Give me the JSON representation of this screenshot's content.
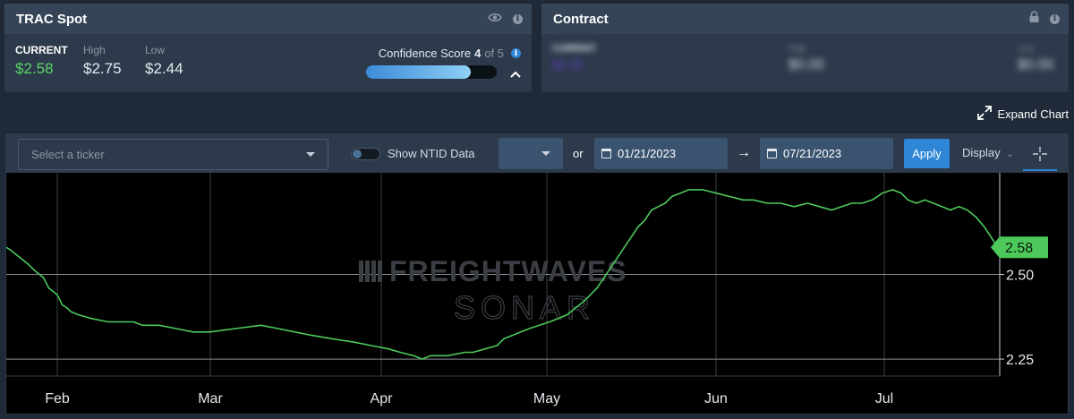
{
  "spot": {
    "title": "TRAC Spot",
    "icons": [
      "eye-icon",
      "info-icon"
    ],
    "current_label": "CURRENT",
    "current_value": "$2.58",
    "high_label": "High",
    "high_value": "$2.75",
    "low_label": "Low",
    "low_value": "$2.44",
    "confidence_label": "Confidence Score",
    "confidence_score": "4",
    "confidence_of": "of 5",
    "confidence_fraction": 0.8
  },
  "contract": {
    "title": "Contract",
    "icons": [
      "lock-icon",
      "info-icon"
    ],
    "current_label": "CURRENT",
    "current_value": "$0.00",
    "high_label": "High",
    "high_value": "$0.00",
    "low_label": "Low",
    "low_value": "$0.00"
  },
  "expand_label": "Expand Chart",
  "toolbar": {
    "ticker_placeholder": "Select a ticker",
    "ntid_label": "Show NTID Data",
    "or_label": "or",
    "start_date": "01/21/2023",
    "end_date": "07/21/2023",
    "apply_label": "Apply",
    "display_label": "Display"
  },
  "watermark": {
    "line1": "FREIGHTWAVES",
    "line2": "SONAR"
  },
  "colors": {
    "line": "#4cc95a",
    "accent": "#2f86d6",
    "positive": "#5fd36a"
  },
  "chart_data": {
    "type": "line",
    "x_labels": [
      "Feb",
      "Mar",
      "Apr",
      "May",
      "Jun",
      "Jul"
    ],
    "y_ticks": [
      "2.25",
      "2.50"
    ],
    "ylim": [
      2.2,
      2.8
    ],
    "last_value_label": "2.58",
    "series": [
      {
        "values": [
          [
            0,
            2.58
          ],
          [
            3,
            2.57
          ],
          [
            8,
            2.55
          ],
          [
            13,
            2.53
          ],
          [
            17,
            2.51
          ],
          [
            22,
            2.49
          ],
          [
            25,
            2.46
          ],
          [
            30,
            2.44
          ],
          [
            33,
            2.41
          ],
          [
            36,
            2.4
          ],
          [
            38,
            2.39
          ],
          [
            43,
            2.38
          ],
          [
            50,
            2.37
          ],
          [
            60,
            2.36
          ],
          [
            75,
            2.36
          ],
          [
            80,
            2.35
          ],
          [
            90,
            2.35
          ],
          [
            100,
            2.34
          ],
          [
            110,
            2.33
          ],
          [
            120,
            2.33
          ],
          [
            135,
            2.34
          ],
          [
            150,
            2.35
          ],
          [
            160,
            2.34
          ],
          [
            170,
            2.33
          ],
          [
            180,
            2.32
          ],
          [
            192,
            2.31
          ],
          [
            205,
            2.3
          ],
          [
            215,
            2.29
          ],
          [
            225,
            2.28
          ],
          [
            232,
            2.27
          ],
          [
            240,
            2.26
          ],
          [
            245,
            2.25
          ],
          [
            250,
            2.26
          ],
          [
            260,
            2.26
          ],
          [
            270,
            2.27
          ],
          [
            275,
            2.27
          ],
          [
            282,
            2.28
          ],
          [
            289,
            2.29
          ],
          [
            293,
            2.31
          ],
          [
            298,
            2.32
          ],
          [
            303,
            2.33
          ],
          [
            308,
            2.34
          ],
          [
            314,
            2.35
          ],
          [
            320,
            2.36
          ],
          [
            325,
            2.37
          ],
          [
            330,
            2.38
          ],
          [
            335,
            2.4
          ],
          [
            340,
            2.42
          ],
          [
            344,
            2.44
          ],
          [
            348,
            2.46
          ],
          [
            352,
            2.49
          ],
          [
            356,
            2.52
          ],
          [
            360,
            2.55
          ],
          [
            364,
            2.58
          ],
          [
            368,
            2.61
          ],
          [
            372,
            2.64
          ],
          [
            376,
            2.66
          ],
          [
            380,
            2.69
          ],
          [
            384,
            2.7
          ],
          [
            388,
            2.71
          ],
          [
            392,
            2.73
          ],
          [
            397,
            2.74
          ],
          [
            402,
            2.75
          ],
          [
            410,
            2.75
          ],
          [
            418,
            2.74
          ],
          [
            426,
            2.73
          ],
          [
            434,
            2.72
          ],
          [
            440,
            2.72
          ],
          [
            448,
            2.71
          ],
          [
            456,
            2.71
          ],
          [
            464,
            2.7
          ],
          [
            472,
            2.71
          ],
          [
            479,
            2.7
          ],
          [
            486,
            2.69
          ],
          [
            492,
            2.7
          ],
          [
            498,
            2.71
          ],
          [
            504,
            2.71
          ],
          [
            510,
            2.72
          ],
          [
            516,
            2.74
          ],
          [
            522,
            2.75
          ],
          [
            527,
            2.74
          ],
          [
            531,
            2.72
          ],
          [
            536,
            2.71
          ],
          [
            541,
            2.72
          ],
          [
            546,
            2.71
          ],
          [
            551,
            2.7
          ],
          [
            556,
            2.69
          ],
          [
            561,
            2.7
          ],
          [
            566,
            2.69
          ],
          [
            571,
            2.67
          ],
          [
            576,
            2.64
          ],
          [
            580,
            2.61
          ],
          [
            584,
            2.58
          ]
        ]
      }
    ]
  }
}
